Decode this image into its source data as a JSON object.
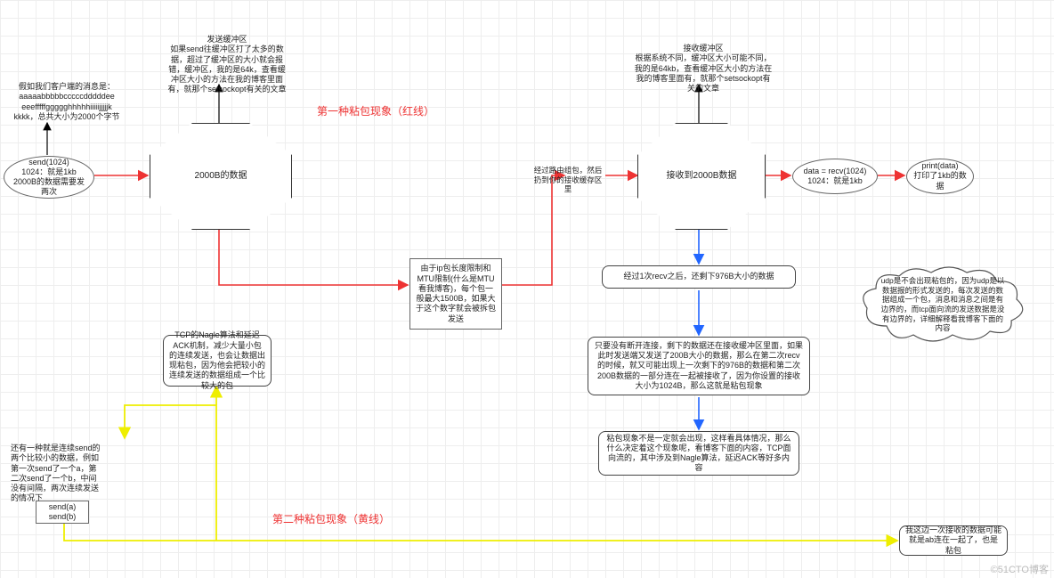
{
  "labels": {
    "title1": "第一种粘包现象（红线）",
    "title2": "第二种粘包现象（黄线）"
  },
  "sendNote": "发送缓冲区\n如果send往缓冲区打了太多的数据，超过了缓冲区的大小就会报错，缓冲区，我的是64k，查看缓冲区大小的方法在我的博客里面有，就那个setsockopt有关的文章",
  "recvNote": "接收缓冲区\n根据系统不同，缓冲区大小可能不同，我的是64kb，查看缓冲区大小的方法在我的博客里面有，就那个setsockopt有关的文章",
  "clientMsg": "假如我们客户端的消息是：\naaaaabbbbbcccccdddddee\neeefffffggggghhhhhiiiiijjjjjk\nkkkk，总共大小为2000个字节",
  "sendCall": "send(1024)\n1024：就是1kb\n2000B的数据需要发两次",
  "sendBuf": "2000B的数据",
  "mtu": "由于ip包长度限制和MTU限制(什么是MTU看我博客)，每个包一般最大1500B，如果大于这个数字就会被拆包发送",
  "route": "经过路由组包，然后扔到你的接收缓存区里",
  "recvBuf": "接收到2000B数据",
  "recvCall": "data = recv(1024)\n1024：就是1kb",
  "printCall": "print(data)\n打印了1kb的数据",
  "step1": "经过1次recv之后，还剩下976B大小的数据",
  "step2": "只要没有断开连接，剩下的数据还在接收缓冲区里面，如果此时发送端又发送了200B大小的数据，那么在第二次recv的时候，就又可能出现上一次剩下的976B的数据和第二次200B数据的一部分连在一起被接收了，因为你设置的接收大小为1024B，那么这就是粘包现象",
  "step3": "粘包现象不是一定就会出现，这样看具体情况，那么什么决定着这个现象呢，看博客下面的内容，TCP面向流的，其中涉及到Nagle算法，延迟ACK等好多内容",
  "nagle": "TCP的Nagle算法和延迟ACK机制，减少大量小包的连续发送，也会让数据出现粘包，因为他会把较小的连续发送的数据组成一个比较大的包",
  "smallSend": "还有一种就是连续send的两个比较小的数据，例如第一次send了一个a，第二次send了一个b，中间没有间隔，两次连续发送的情况下",
  "sendAB": "send(a)\nsend(b)",
  "mergedAB": "我这边一次接收的数据可能就是ab连在一起了，也是粘包",
  "udpNote": "udp是不会出现粘包的，因为udp是以数据报的形式发送的，每次发送的数据组成一个包，消息和消息之间是有边界的，而tcp面向流的发送数据是没有边界的，详细解释看我博客下面的内容",
  "watermark": "©51CTO博客"
}
